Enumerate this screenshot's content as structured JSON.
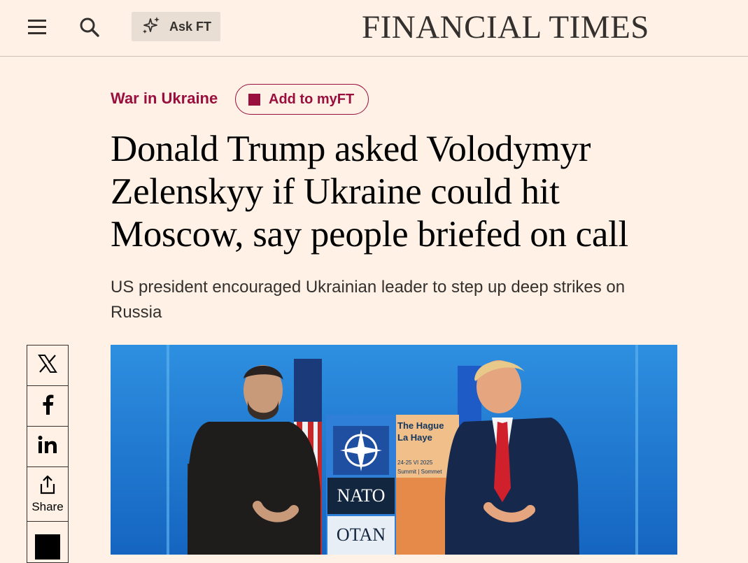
{
  "header": {
    "menu_icon": "hamburger-icon",
    "search_icon": "search-icon",
    "ask_ft": {
      "icon": "sparkle-icon",
      "label": "Ask FT"
    },
    "logo": "FINANCIAL TIMES"
  },
  "article": {
    "topic": "War in Ukraine",
    "add_to_myft": "Add to myFT",
    "headline": "Donald Trump asked Volodymyr Zelenskyy if Ukraine could hit Moscow, say people briefed on call",
    "standfirst": "US president encouraged Ukrainian leader to step up deep strikes on Russia"
  },
  "share": {
    "items": [
      {
        "icon": "x-twitter-icon"
      },
      {
        "icon": "facebook-icon"
      },
      {
        "icon": "linkedin-icon"
      },
      {
        "icon": "share-icon",
        "label": "Share"
      },
      {
        "icon": "save-icon"
      }
    ]
  },
  "hero_image": {
    "backdrop_text": {
      "line1": "The Hague",
      "line2": "La Haye",
      "dates": "24-25 VI 2025",
      "summit": "Summit | Sommet",
      "nato": "NATO",
      "otan": "OTAN"
    }
  },
  "colors": {
    "background": "#FFF1E5",
    "claret": "#990F3D",
    "text": "#33302E"
  }
}
